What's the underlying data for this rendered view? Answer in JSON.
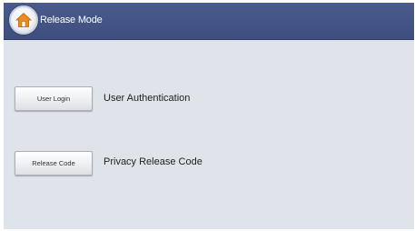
{
  "header": {
    "title": "Release Mode",
    "home_icon": "home-icon",
    "background_color": "#42538a"
  },
  "options": [
    {
      "button_label": "User Login",
      "description": "User Authentication"
    },
    {
      "button_label": "Release Code",
      "description": "Privacy Release Code"
    }
  ],
  "colors": {
    "panel_background": "#dfe3ea",
    "home_icon_orange": "#f08a1c"
  }
}
